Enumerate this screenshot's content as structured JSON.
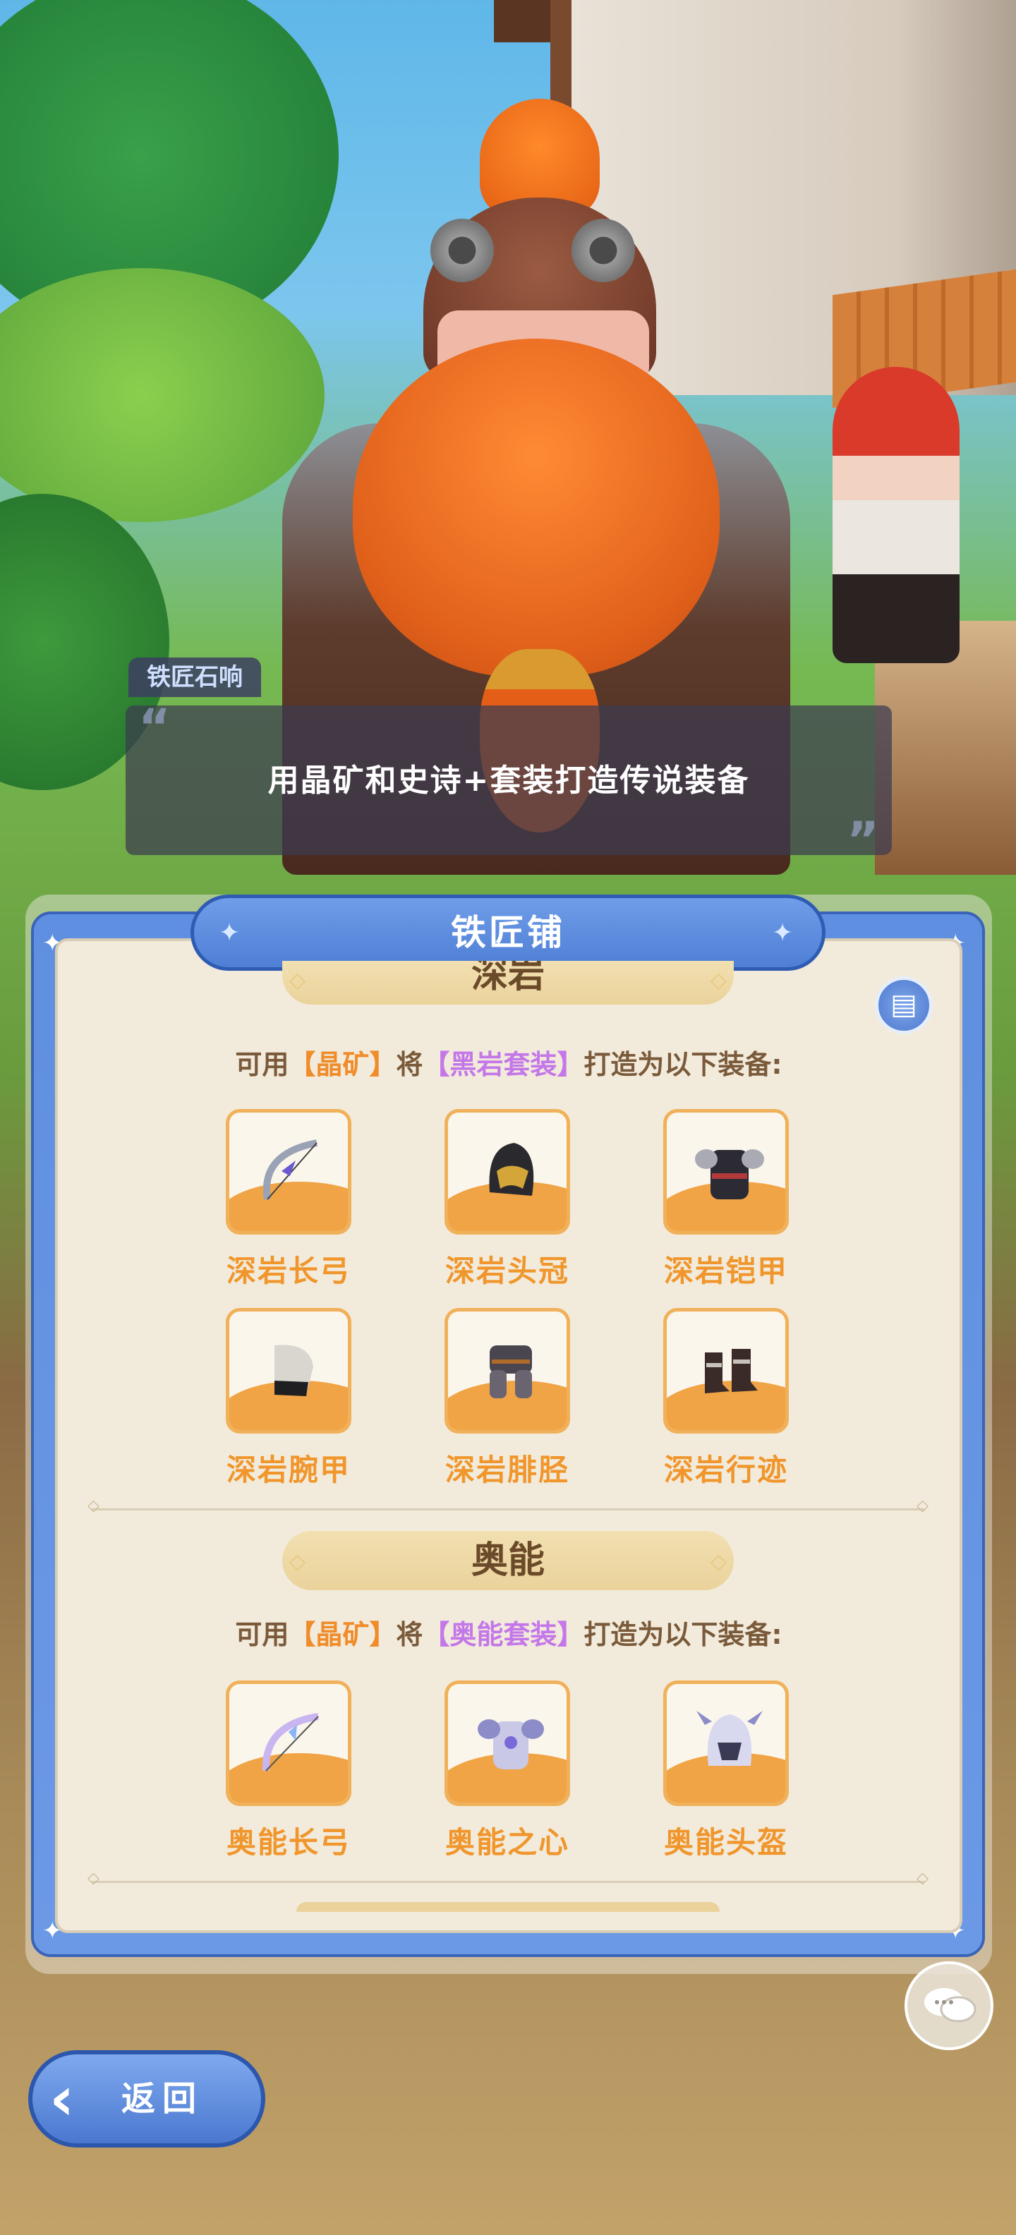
{
  "dialog": {
    "speaker": "铁匠石响",
    "text": "用晶矿和史诗+套装打造传说装备"
  },
  "panel": {
    "title": "铁匠铺"
  },
  "sections": [
    {
      "name": "深岩",
      "desc_prefix": "可用",
      "ore": "【晶矿】",
      "desc_mid": "将",
      "set": "【黑岩套装】",
      "desc_suffix": "打造为以下装备:",
      "items": [
        {
          "name": "深岩长弓",
          "icon": "longbow-icon"
        },
        {
          "name": "深岩头冠",
          "icon": "helmet-icon"
        },
        {
          "name": "深岩铠甲",
          "icon": "armor-icon"
        },
        {
          "name": "深岩腕甲",
          "icon": "bracer-icon"
        },
        {
          "name": "深岩腓胫",
          "icon": "greaves-icon"
        },
        {
          "name": "深岩行迹",
          "icon": "boots-icon"
        }
      ]
    },
    {
      "name": "奥能",
      "desc_prefix": "可用",
      "ore": "【晶矿】",
      "desc_mid": "将",
      "set": "【奥能套装】",
      "desc_suffix": "打造为以下装备:",
      "items": [
        {
          "name": "奥能长弓",
          "icon": "longbow-icon"
        },
        {
          "name": "奥能之心",
          "icon": "chest-armor-icon"
        },
        {
          "name": "奥能头盔",
          "icon": "helmet-icon"
        }
      ]
    }
  ],
  "controls": {
    "back_label": "返回",
    "chat_icon": "chat-bubble-icon",
    "info_icon": "book-icon"
  },
  "colors": {
    "panel_blue": "#5f8fe0",
    "ore_orange": "#f08c2a",
    "set_purple": "#c478e8",
    "item_name": "#f0962c"
  }
}
